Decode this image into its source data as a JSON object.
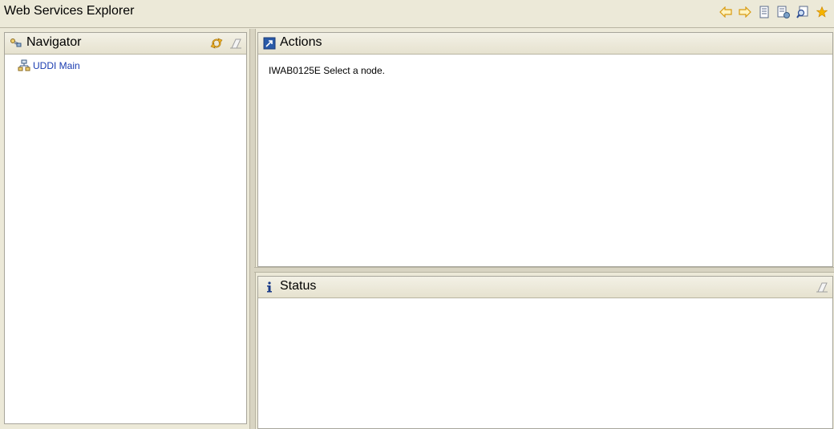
{
  "app": {
    "title": "Web Services Explorer"
  },
  "toolbar": {
    "buttons": [
      {
        "icon": "back-arrow-icon",
        "color": "#e0a020"
      },
      {
        "icon": "forward-arrow-icon",
        "color": "#e0a020"
      },
      {
        "icon": "document-icon"
      },
      {
        "icon": "document-settings-icon"
      },
      {
        "icon": "search-icon"
      },
      {
        "icon": "favorites-star-icon",
        "color": "#f0a000"
      }
    ]
  },
  "navigator": {
    "title": "Navigator",
    "tree": [
      {
        "label": "UDDI Main",
        "icon": "registry-icon"
      }
    ]
  },
  "actions": {
    "title": "Actions",
    "message": "IWAB0125E Select a node."
  },
  "status": {
    "title": "Status"
  }
}
